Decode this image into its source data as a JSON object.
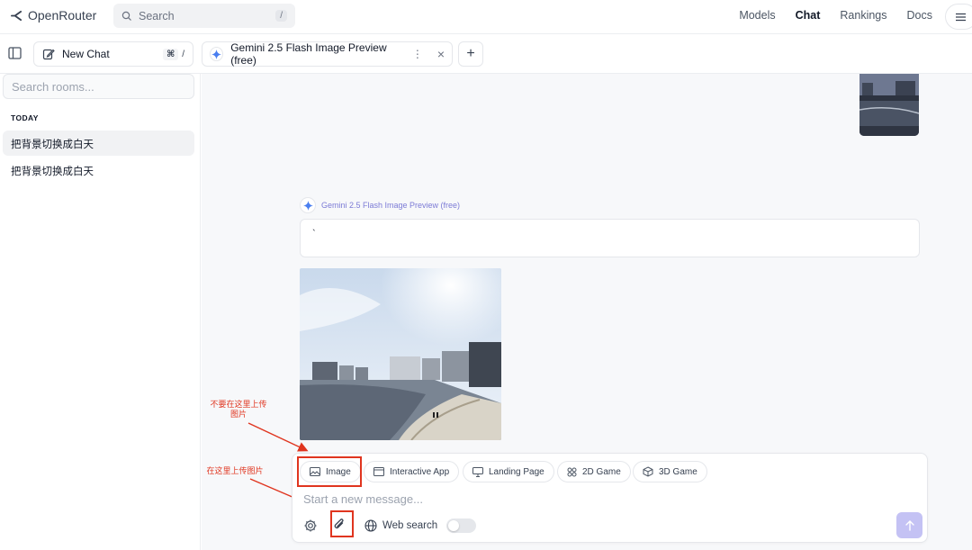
{
  "app": {
    "name": "OpenRouter"
  },
  "search": {
    "placeholder": "Search",
    "shortcut": "/"
  },
  "nav": {
    "items": [
      "Models",
      "Chat",
      "Rankings",
      "Docs"
    ],
    "active": "Chat"
  },
  "tabs": {
    "new_chat_label": "New Chat",
    "new_chat_shortcut": [
      "⌘",
      "/"
    ],
    "model_tab_label": "Gemini 2.5 Flash Image Preview (free)",
    "add_tab": "+"
  },
  "sidebar": {
    "search_placeholder": "Search rooms...",
    "section_label": "TODAY",
    "rooms": [
      "把背景切换成白天",
      "把背景切换成白天"
    ]
  },
  "conversation": {
    "model_name": "Gemini 2.5 Flash Image Preview (free)",
    "response_text": "`"
  },
  "annotations": {
    "note1": "不要在这里上传图片",
    "note2": "在这里上传图片",
    "color": "#e0351f"
  },
  "composer": {
    "chips": [
      "Image",
      "Interactive App",
      "Landing Page",
      "2D Game",
      "3D Game"
    ],
    "placeholder": "Start a new message...",
    "web_search_label": "Web search",
    "web_search_enabled": false
  },
  "colors": {
    "accent": "#7c7bd6",
    "send_button": "#c4c2f4"
  }
}
